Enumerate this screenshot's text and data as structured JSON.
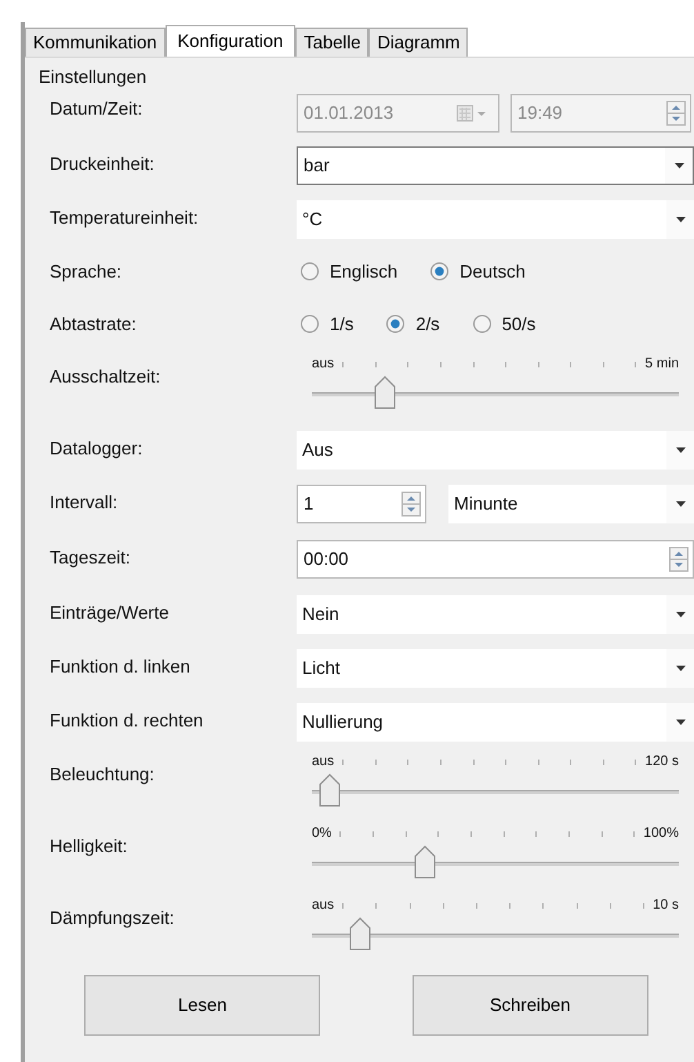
{
  "tabs": [
    {
      "label": "Kommunikation",
      "selected": false
    },
    {
      "label": "Konfiguration",
      "selected": true
    },
    {
      "label": "Tabelle",
      "selected": false
    },
    {
      "label": "Diagramm",
      "selected": false
    }
  ],
  "group": {
    "title": "Einstellungen",
    "rows": [
      {
        "kind": "datetime",
        "label": "Datum/Zeit:",
        "date": "01.01.2013",
        "time": "19:49",
        "disabled": true
      },
      {
        "kind": "combo",
        "label": "Druckeinheit:",
        "value": "bar",
        "focused": true
      },
      {
        "kind": "combo",
        "label": "Temperatureinheit:",
        "value": "°C",
        "focused": false
      },
      {
        "kind": "radio",
        "label": "Sprache:",
        "options": [
          {
            "label": "Englisch",
            "selected": false
          },
          {
            "label": "Deutsch",
            "selected": true
          }
        ]
      },
      {
        "kind": "radio",
        "label": "Abtastrate:",
        "options": [
          {
            "label": "1/s",
            "selected": false
          },
          {
            "label": "2/s",
            "selected": true
          },
          {
            "label": "50/s",
            "selected": false
          }
        ]
      },
      {
        "kind": "slider",
        "label": "Ausschaltzeit:",
        "min": "aus",
        "max": "5 min",
        "level": 0.2
      },
      {
        "kind": "combo",
        "label": "Datalogger:",
        "value": "Aus",
        "focused": false
      },
      {
        "kind": "spin-combo",
        "label": "Intervall:",
        "number": "1",
        "unit": "Minunte"
      },
      {
        "kind": "time",
        "label": "Tageszeit:",
        "value": "00:00"
      },
      {
        "kind": "combo",
        "label": "Einträge/Werte",
        "value": "Nein",
        "focused": false
      },
      {
        "kind": "combo",
        "label": "Funktion d. linken",
        "value": "Licht",
        "focused": false
      },
      {
        "kind": "combo",
        "label": "Funktion d. rechten",
        "value": "Nullierung",
        "focused": false
      },
      {
        "kind": "slider",
        "label": "Beleuchtung:",
        "min": "aus",
        "max": "120 s",
        "level": 0.05
      },
      {
        "kind": "slider",
        "label": "Helligkeit:",
        "min": "0%",
        "max": "100%",
        "level": 0.31
      },
      {
        "kind": "slider",
        "label": "Dämpfungszeit:",
        "min": "aus",
        "max": "10 s",
        "level": 0.13
      }
    ]
  },
  "buttons": [
    "Lesen",
    "Schreiben"
  ]
}
